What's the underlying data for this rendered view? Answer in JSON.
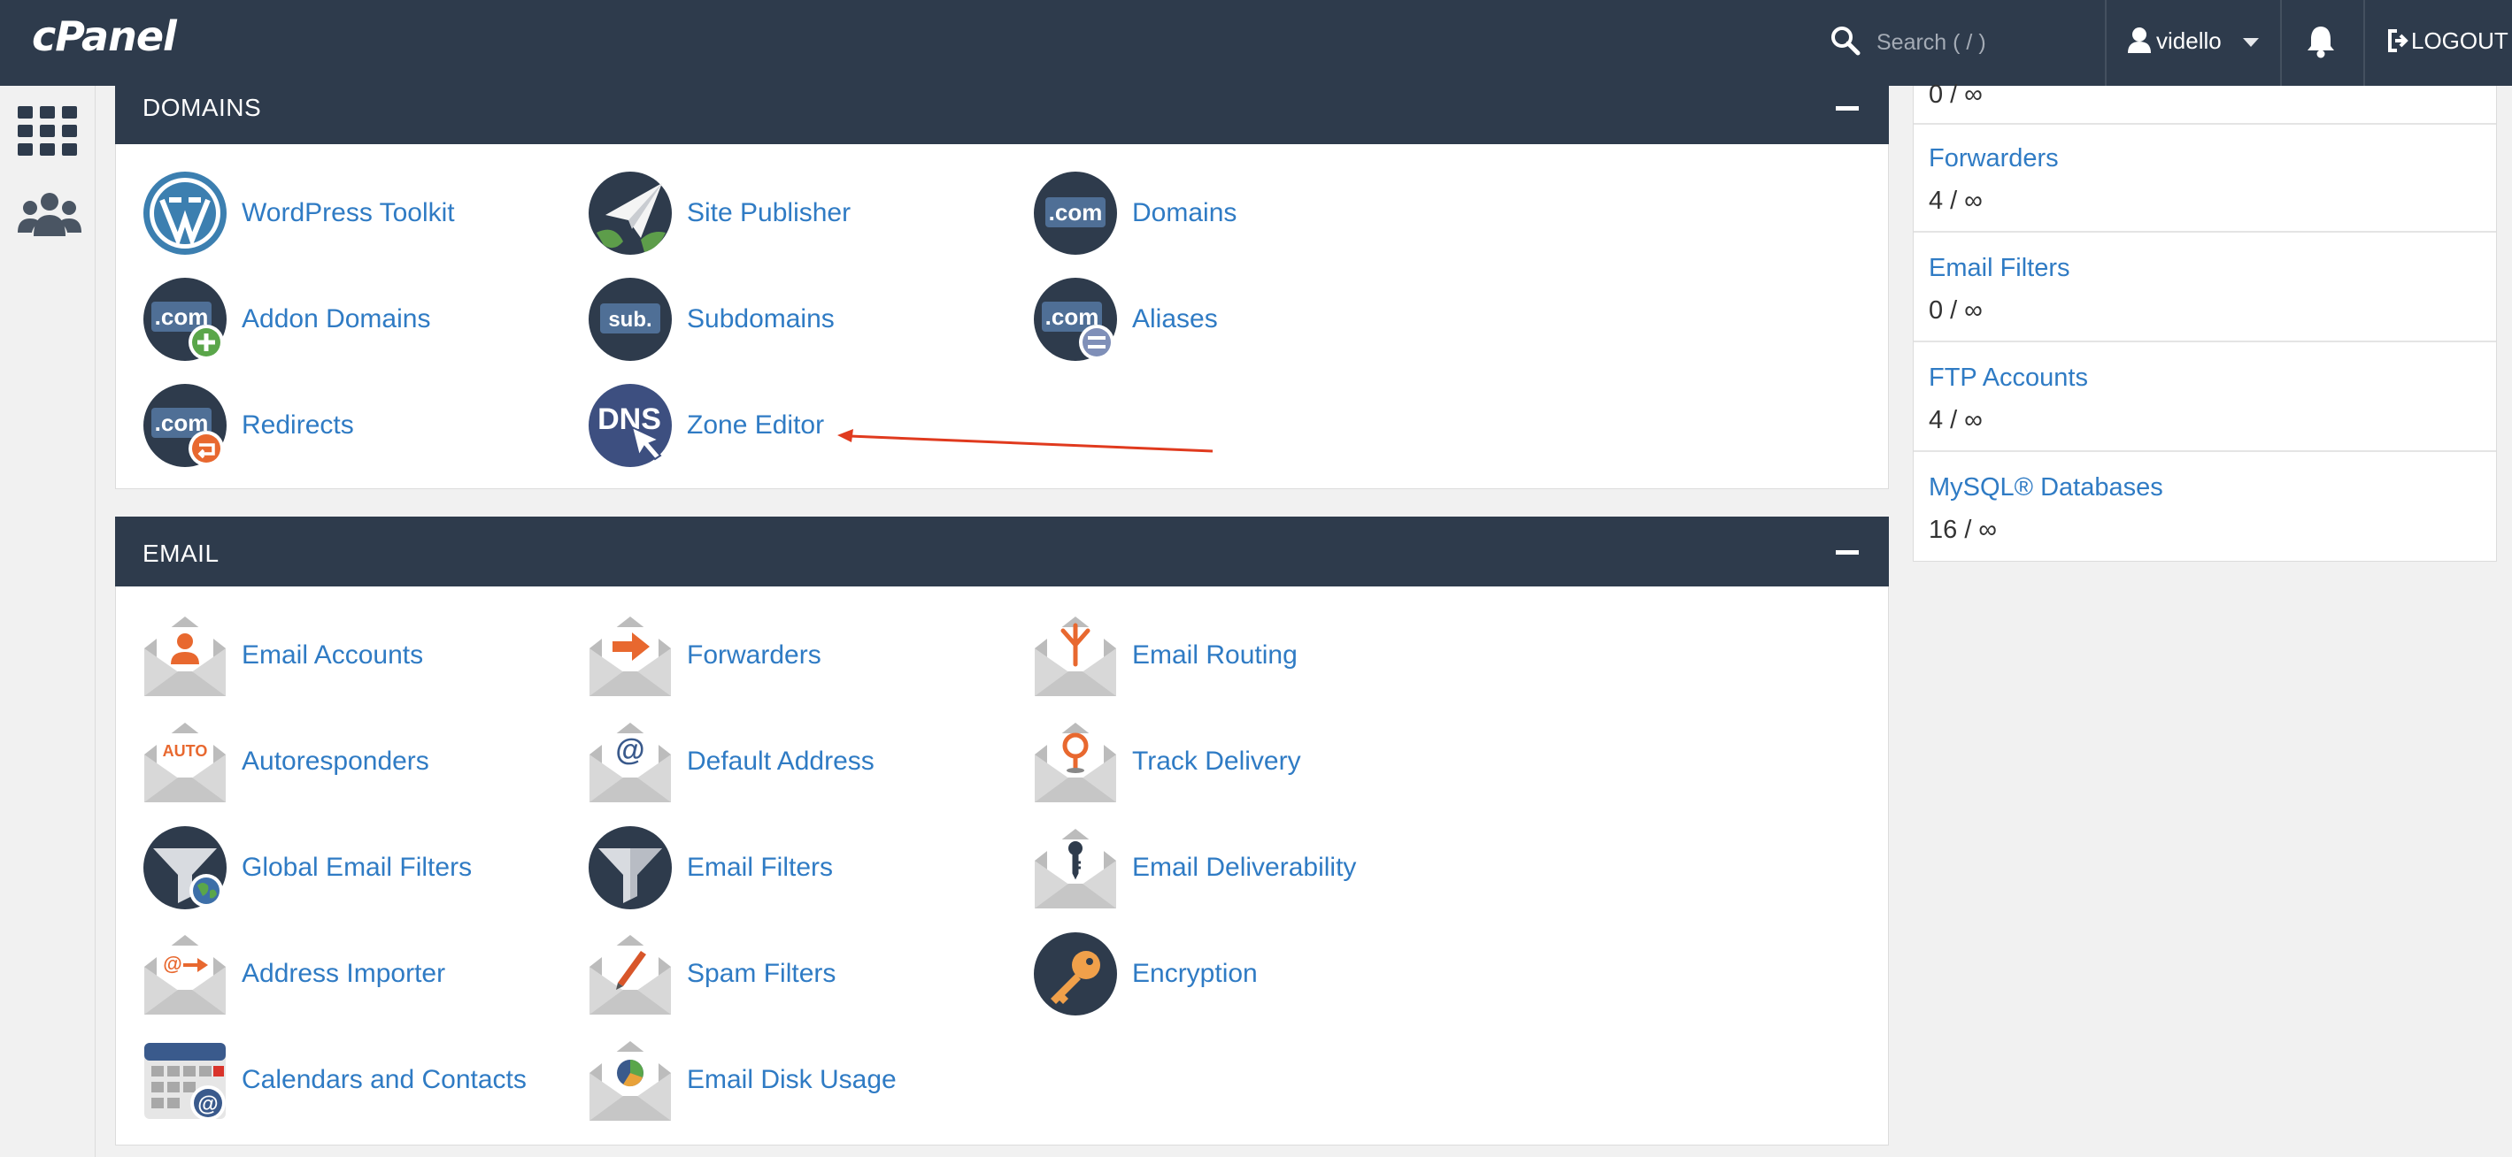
{
  "app": {
    "logo": "cPanel"
  },
  "topbar": {
    "search_placeholder": "Search ( / )",
    "username": "vidello",
    "logout_label": "LOGOUT"
  },
  "domains": {
    "title": "DOMAINS",
    "items": [
      {
        "label": "WordPress Toolkit"
      },
      {
        "label": "Site Publisher"
      },
      {
        "label": "Domains"
      },
      {
        "label": "Addon Domains"
      },
      {
        "label": "Subdomains"
      },
      {
        "label": "Aliases"
      },
      {
        "label": "Redirects"
      },
      {
        "label": "Zone Editor"
      }
    ]
  },
  "email": {
    "title": "EMAIL",
    "items": [
      {
        "label": "Email Accounts"
      },
      {
        "label": "Forwarders"
      },
      {
        "label": "Email Routing"
      },
      {
        "label": "Autoresponders"
      },
      {
        "label": "Default Address"
      },
      {
        "label": "Track Delivery"
      },
      {
        "label": "Global Email Filters"
      },
      {
        "label": "Email Filters"
      },
      {
        "label": "Email Deliverability"
      },
      {
        "label": "Address Importer"
      },
      {
        "label": "Spam Filters"
      },
      {
        "label": "Encryption"
      },
      {
        "label": "Calendars and Contacts"
      },
      {
        "label": "Email Disk Usage"
      }
    ]
  },
  "stats": {
    "top_partial_value": "0 / ∞",
    "rows": [
      {
        "name": "Forwarders",
        "value": "4 / ∞"
      },
      {
        "name": "Email Filters",
        "value": "0 / ∞"
      },
      {
        "name": "FTP Accounts",
        "value": "4 / ∞"
      },
      {
        "name": "MySQL® Databases",
        "value": "16 / ∞"
      }
    ]
  },
  "icon_text": {
    "com": ".com",
    "sub": "sub.",
    "dns": "DNS",
    "auto": "AUTO",
    "at": "@"
  },
  "colors": {
    "topbar": "#2e3b4c",
    "link": "#2f7bc4",
    "accent_orange": "#e8682f",
    "annotation_arrow": "#e03a1e"
  }
}
